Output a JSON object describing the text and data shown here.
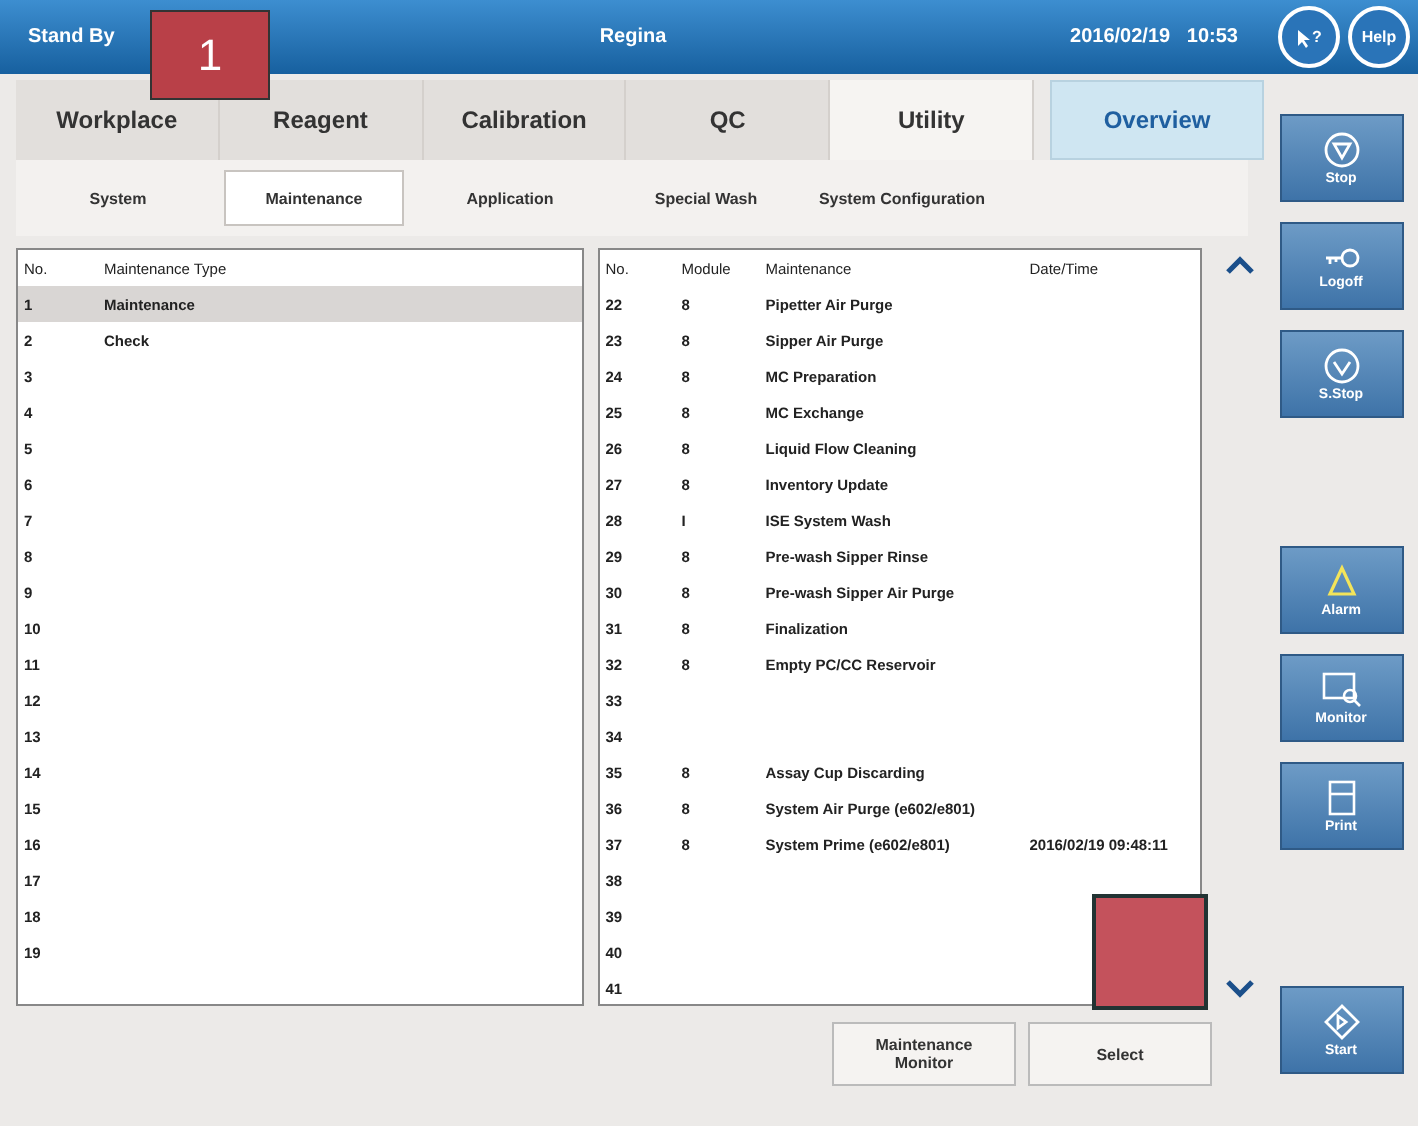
{
  "header": {
    "status": "Stand By",
    "user": "Regina",
    "date": "2016/02/19",
    "time": "10:53",
    "help_buttons": [
      {
        "label": "?",
        "kind": "pointer"
      },
      {
        "label": "Help",
        "kind": "plain"
      }
    ]
  },
  "callout": {
    "label": "1"
  },
  "tabs": [
    {
      "label": "Workplace",
      "selected": false
    },
    {
      "label": "Reagent",
      "selected": false
    },
    {
      "label": "Calibration",
      "selected": false
    },
    {
      "label": "QC",
      "selected": false
    },
    {
      "label": "Utility",
      "selected": true
    }
  ],
  "overview_button": {
    "label": "Overview"
  },
  "subtabs": [
    {
      "label": "System",
      "selected": false
    },
    {
      "label": "Maintenance",
      "selected": true
    },
    {
      "label": "Application",
      "selected": false
    },
    {
      "label": "Special Wash",
      "selected": false
    },
    {
      "label": "System Configuration",
      "selected": false
    }
  ],
  "type_table": {
    "columns": [
      "No.",
      "Maintenance Type"
    ],
    "rows": [
      {
        "no": "1",
        "type": "Maintenance",
        "selected": true
      },
      {
        "no": "2",
        "type": "Check",
        "selected": false
      },
      {
        "no": "3",
        "selected": false
      },
      {
        "no": "4",
        "selected": false
      },
      {
        "no": "5",
        "selected": false
      },
      {
        "no": "6",
        "selected": false
      },
      {
        "no": "7",
        "selected": false
      },
      {
        "no": "8",
        "selected": false
      },
      {
        "no": "9",
        "selected": false
      },
      {
        "no": "10",
        "selected": false
      },
      {
        "no": "11",
        "selected": false
      },
      {
        "no": "12",
        "selected": false
      },
      {
        "no": "13",
        "selected": false
      },
      {
        "no": "14",
        "selected": false
      },
      {
        "no": "15",
        "selected": false
      },
      {
        "no": "16",
        "selected": false
      },
      {
        "no": "17",
        "selected": false
      },
      {
        "no": "18",
        "selected": false
      },
      {
        "no": "19",
        "selected": false
      }
    ]
  },
  "maintenance_table": {
    "columns": [
      "No.",
      "Module",
      "Maintenance",
      "Date/Time"
    ],
    "rows": [
      {
        "no": "22",
        "module": "8",
        "name": "Pipetter Air Purge"
      },
      {
        "no": "23",
        "module": "8",
        "name": "Sipper Air Purge"
      },
      {
        "no": "24",
        "module": "8",
        "name": "MC Preparation"
      },
      {
        "no": "25",
        "module": "8",
        "name": "MC Exchange"
      },
      {
        "no": "26",
        "module": "8",
        "name": "Liquid Flow Cleaning"
      },
      {
        "no": "27",
        "module": "8",
        "name": "Inventory Update"
      },
      {
        "no": "28",
        "module": "I",
        "name": "ISE System Wash"
      },
      {
        "no": "29",
        "module": "8",
        "name": "Pre-wash Sipper Rinse"
      },
      {
        "no": "30",
        "module": "8",
        "name": "Pre-wash Sipper Air Purge"
      },
      {
        "no": "31",
        "module": "8",
        "name": "Finalization"
      },
      {
        "no": "32",
        "module": "8",
        "name": "Empty PC/CC Reservoir"
      },
      {
        "no": "33"
      },
      {
        "no": "34"
      },
      {
        "no": "35",
        "module": "8",
        "name": "Assay Cup Discarding"
      },
      {
        "no": "36",
        "module": "8",
        "name": "System Air Purge (e602/e801)"
      },
      {
        "no": "37",
        "module": "8",
        "name": "System Prime (e602/e801)",
        "datetime": "2016/02/19 09:48:11"
      },
      {
        "no": "38"
      },
      {
        "no": "39"
      },
      {
        "no": "40"
      },
      {
        "no": "41"
      }
    ]
  },
  "bottom_buttons": [
    "Maintenance Monitor",
    "Select"
  ],
  "side_buttons": [
    {
      "label": "Stop",
      "kind": "stop"
    },
    {
      "label": "Logoff",
      "kind": "logoff"
    },
    {
      "label": "S.Stop",
      "kind": "sstop"
    },
    {
      "kind": "gap"
    },
    {
      "label": "Alarm",
      "kind": "alarm"
    },
    {
      "label": "Monitor",
      "kind": "monitor"
    },
    {
      "label": "Print",
      "kind": "print"
    },
    {
      "kind": "gap"
    },
    {
      "label": "Start",
      "kind": "start"
    }
  ]
}
